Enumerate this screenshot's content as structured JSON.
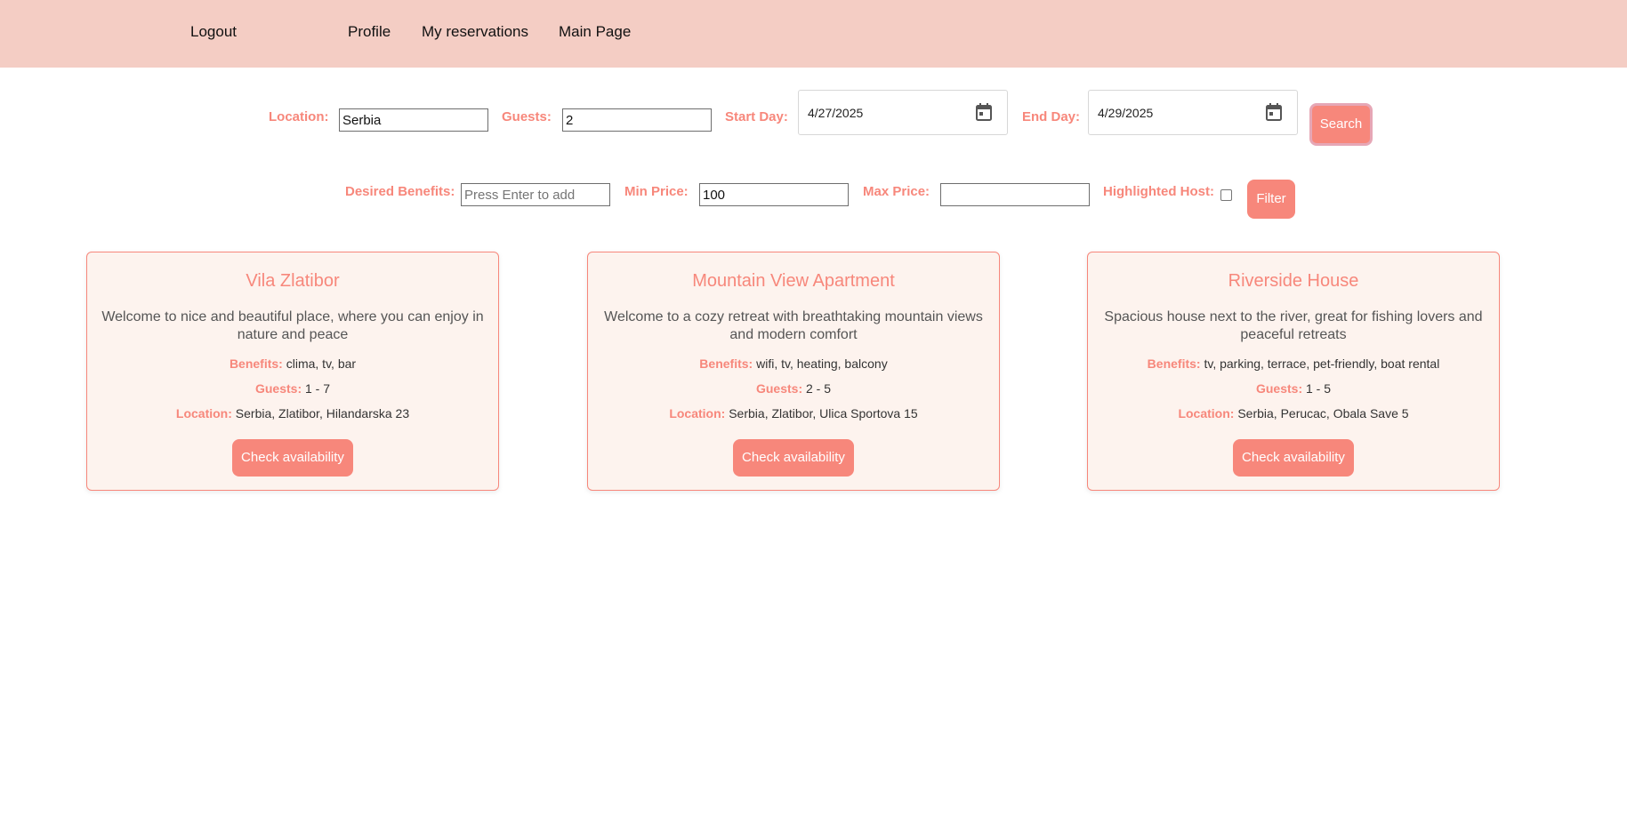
{
  "nav": {
    "logout": "Logout",
    "profile": "Profile",
    "reservations": "My reservations",
    "main_page": "Main Page"
  },
  "search": {
    "location_label": "Location:",
    "location_value": "Serbia",
    "guests_label": "Guests:",
    "guests_value": "2",
    "start_label": "Start Day:",
    "start_value": "4/27/2025",
    "end_label": "End Day:",
    "end_value": "4/29/2025",
    "button": "Search"
  },
  "filter": {
    "benefits_label": "Desired Benefits:",
    "benefits_placeholder": "Press Enter to add",
    "min_label": "Min Price:",
    "min_value": "100",
    "max_label": "Max Price:",
    "max_value": "",
    "highlighted_label": "Highlighted Host:",
    "highlighted_checked": false,
    "button": "Filter"
  },
  "colors": {
    "accent": "#f7877b",
    "topbar": "#f4cdc4",
    "card_bg": "#fdf3ee"
  },
  "cards": [
    {
      "title": "Vila Zlatibor",
      "description": "Welcome to nice and beautiful place, where you can enjoy in nature and peace",
      "benefits_label": "Benefits:",
      "benefits": "clima, tv, bar",
      "guests_label": "Guests:",
      "guests": "1 - 7",
      "location_label": "Location:",
      "location": "Serbia, Zlatibor, Hilandarska 23",
      "button": "Check availability"
    },
    {
      "title": "Mountain View Apartment",
      "description": "Welcome to a cozy retreat with breathtaking mountain views and modern comfort",
      "benefits_label": "Benefits:",
      "benefits": "wifi, tv, heating, balcony",
      "guests_label": "Guests:",
      "guests": "2 - 5",
      "location_label": "Location:",
      "location": "Serbia, Zlatibor, Ulica Sportova 15",
      "button": "Check availability"
    },
    {
      "title": "Riverside House",
      "description": "Spacious house next to the river, great for fishing lovers and peaceful retreats",
      "benefits_label": "Benefits:",
      "benefits": "tv, parking, terrace, pet-friendly, boat rental",
      "guests_label": "Guests:",
      "guests": "1 - 5",
      "location_label": "Location:",
      "location": "Serbia, Perucac, Obala Save 5",
      "button": "Check availability"
    }
  ]
}
